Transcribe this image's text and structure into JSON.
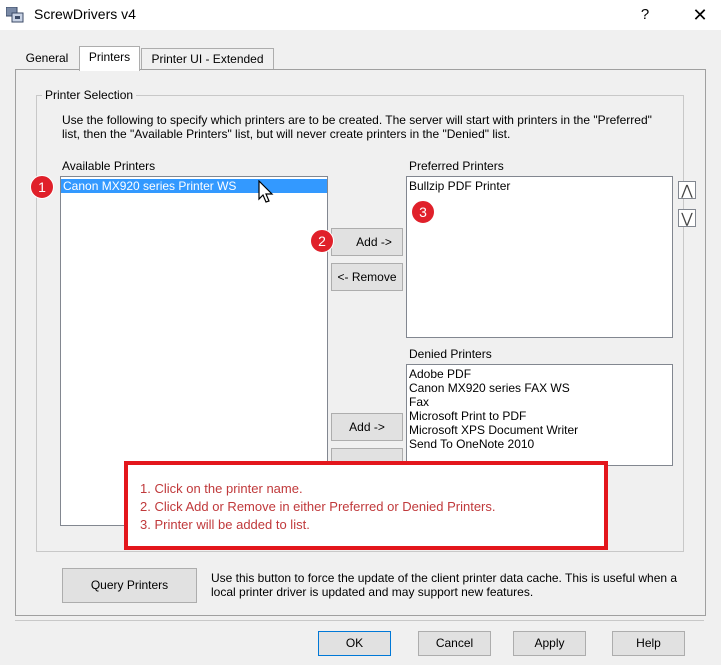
{
  "window": {
    "title": "ScrewDrivers v4",
    "help_glyph": "?",
    "close_glyph": "✕"
  },
  "tabs": [
    {
      "label": "General"
    },
    {
      "label": "Printers"
    },
    {
      "label": "Printer UI - Extended"
    }
  ],
  "printer_selection": {
    "group_label": "Printer Selection",
    "instructions": "Use the following to specify which printers are to be created.  The server will start with printers in the \"Preferred\" list, then the \"Available Printers\" list, but will never create printers in the \"Denied\" list.",
    "available": {
      "label": "Available Printers",
      "items": [
        "Canon MX920 series Printer WS"
      ],
      "selected": "Canon MX920 series Printer WS"
    },
    "preferred": {
      "label": "Preferred Printers",
      "items": [
        "Bullzip PDF Printer"
      ],
      "move_up_glyph": "⋀",
      "move_down_glyph": "⋁"
    },
    "denied": {
      "label": "Denied Printers",
      "items": [
        "Adobe PDF",
        "Canon MX920 series FAX WS",
        "Fax",
        "Microsoft Print to PDF",
        "Microsoft XPS Document Writer",
        "Send To OneNote 2010"
      ]
    },
    "buttons": {
      "add_preferred": "Add ->",
      "remove_preferred": "<- Remove",
      "add_denied": "Add ->"
    }
  },
  "query": {
    "button": "Query Printers",
    "description": "Use this button to force the update of the client printer data cache.  This is useful when a local printer driver is updated and may support new features."
  },
  "footer": {
    "ok": "OK",
    "cancel": "Cancel",
    "apply": "Apply",
    "help": "Help"
  },
  "annotations": {
    "badges": [
      "1",
      "2",
      "3"
    ],
    "steps": [
      "1.  Click on the printer name.",
      "2.  Click Add or Remove in either Preferred or Denied Printers.",
      "3.  Printer will be added to list."
    ],
    "badge_color": "#e0202a",
    "callout_border_color": "#e3161c",
    "step_text_color": "#c0393b"
  },
  "colors": {
    "selection": "#3399ff",
    "dialog_bg": "#f0f0f0"
  }
}
